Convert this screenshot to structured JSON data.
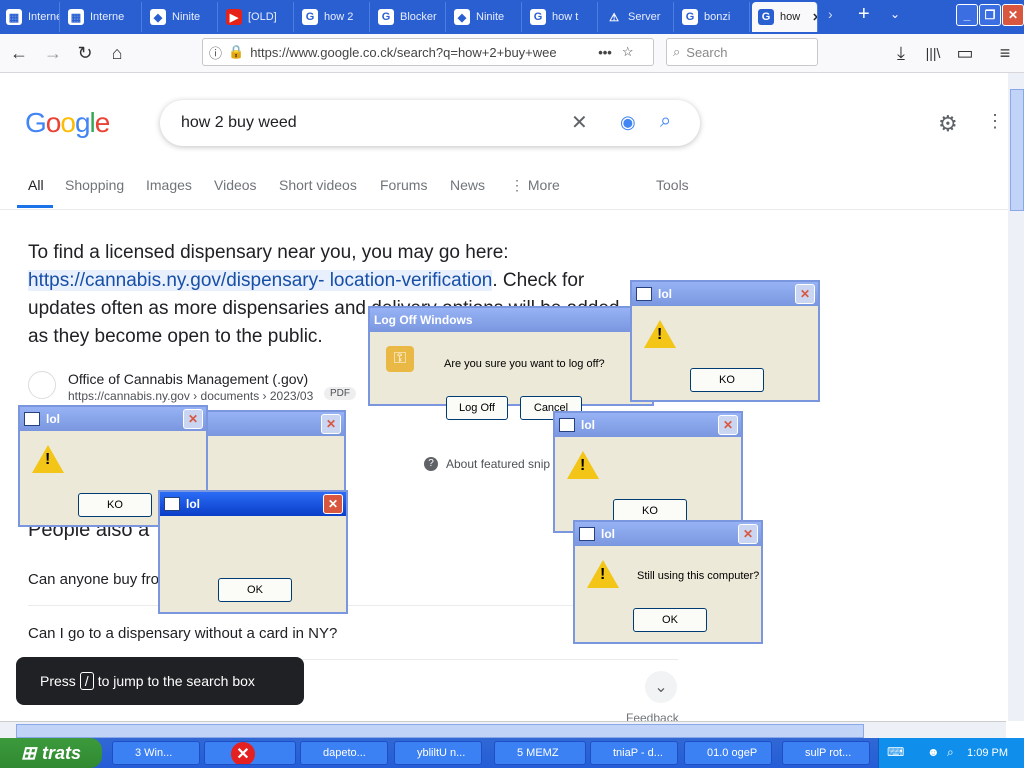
{
  "browser": {
    "tabs": [
      {
        "label": "Interne",
        "icon": "windows-icon"
      },
      {
        "label": "Ninite",
        "icon": "ninite-icon"
      },
      {
        "label": "[OLD]",
        "icon": "youtube-icon"
      },
      {
        "label": "how 2",
        "icon": "google-icon"
      },
      {
        "label": "Blocker",
        "icon": "google-icon"
      },
      {
        "label": "Ninite",
        "icon": "ninite-icon"
      },
      {
        "label": "how t",
        "icon": "google-icon"
      },
      {
        "label": "Server",
        "icon": "warning-icon"
      },
      {
        "label": "bonzi",
        "icon": "google-icon"
      },
      {
        "label": "how",
        "icon": "google-icon"
      }
    ],
    "url": "https://www.google.co.ck/search?q=how+2+buy+wee",
    "search_placeholder": "Search"
  },
  "google": {
    "query": "how 2 buy weed",
    "tabs": [
      "All",
      "Shopping",
      "Images",
      "Videos",
      "Short videos",
      "Forums",
      "News",
      "More",
      "Tools"
    ],
    "snippet_pre": "To find a licensed dispensary near you, you may go here: ",
    "snippet_link": "https://cannabis.ny.gov/dispensary- location-verification",
    "snippet_post": ". Check for updates often as more dispensaries and delivery options will be added as they become open to the public.",
    "source_name": "Office of Cannabis Management (.gov)",
    "source_url": "https://cannabis.ny.gov › documents › 2023/03",
    "source_badge": "PDF",
    "about_featured": "About featured snip",
    "paa_title": "People also a",
    "questions": [
      "Can anyone buy fro",
      "Can I go to a dispensary without a card in NY?"
    ],
    "jump_pre": "Press",
    "jump_key": "/",
    "jump_post": "to jump to the search box",
    "feedback": "Feedback"
  },
  "dialogs": {
    "logoff": {
      "title": "Log Off Windows",
      "message": "Are you sure you want to log off?",
      "btn_ok": "Log Off",
      "btn_cancel": "Cancel"
    },
    "lol_title": "lol",
    "lol_ko": "KO",
    "lol_ok": "OK",
    "still_using": "Still using this computer?"
  },
  "taskbar": {
    "start_label": "trats",
    "items": [
      "3 Win...",
      "",
      "dapeto...",
      "ybliltU n...",
      "5 MEMZ",
      "tniaP - d...",
      "01.0 ogeP",
      "sulP rot..."
    ],
    "clock": "1:09 PM"
  }
}
